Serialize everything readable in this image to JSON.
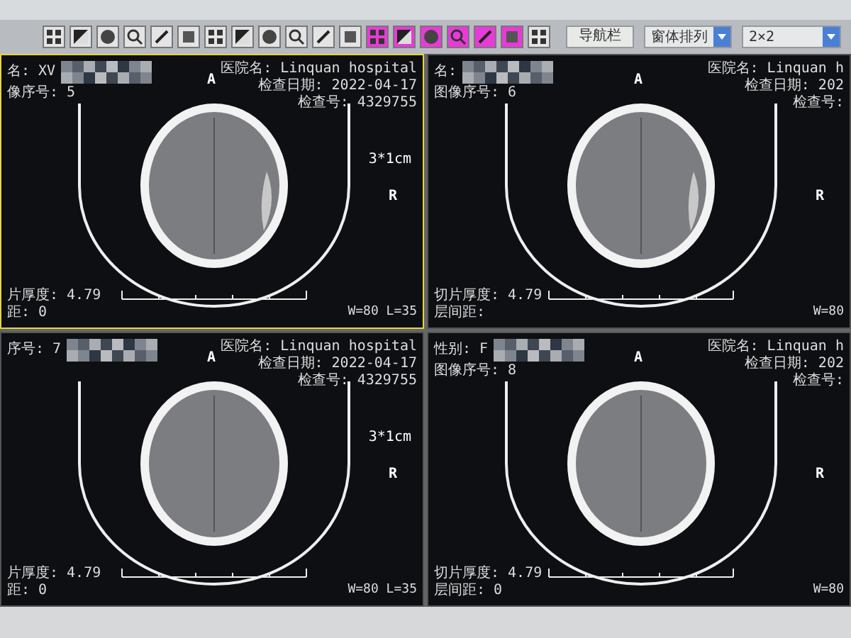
{
  "toolbar": {
    "tools": [
      {
        "active": false
      },
      {
        "active": false
      },
      {
        "active": false
      },
      {
        "active": false
      },
      {
        "active": false
      },
      {
        "active": false
      },
      {
        "active": false
      },
      {
        "active": false
      },
      {
        "active": false
      },
      {
        "active": false
      },
      {
        "active": false
      },
      {
        "active": false
      },
      {
        "active": true
      },
      {
        "active": true
      },
      {
        "active": true
      },
      {
        "active": true
      },
      {
        "active": true
      },
      {
        "active": true
      },
      {
        "active": false
      }
    ],
    "nav_button": "导航栏",
    "layout_select": "窗体排列",
    "grid_select": "2×2"
  },
  "viewports": [
    {
      "selected": true,
      "patient_lines": [
        "名: XV",
        "像序号: 5"
      ],
      "orientation_top": "A",
      "orientation_right": "R",
      "scale_label": "3*1cm",
      "hospital_lines": [
        "医院名: Linquan hospital",
        "检查日期: 2022-04-17",
        "检查号: 4329755"
      ],
      "slice_lines": [
        "片厚度: 4.79",
        "距: 0"
      ],
      "window": "W=80 L=35",
      "lesion": true
    },
    {
      "selected": false,
      "patient_lines": [
        "名:",
        "图像序号: 6"
      ],
      "orientation_top": "A",
      "orientation_right": "R",
      "hospital_lines": [
        "医院名: Linquan h",
        "检查日期: 202",
        "检查号:"
      ],
      "slice_lines": [
        "切片厚度: 4.79",
        "层间距:"
      ],
      "window": "W=80",
      "lesion": true
    },
    {
      "selected": false,
      "patient_lines": [
        "序号: 7"
      ],
      "orientation_top": "A",
      "orientation_right": "R",
      "scale_label": "3*1cm",
      "hospital_lines": [
        "医院名: Linquan hospital",
        "检查日期: 2022-04-17",
        "检查号: 4329755"
      ],
      "slice_lines": [
        "片厚度: 4.79",
        "距: 0"
      ],
      "window": "W=80 L=35",
      "lesion": false
    },
    {
      "selected": false,
      "patient_lines": [
        "性别: F",
        "图像序号: 8"
      ],
      "orientation_top": "A",
      "orientation_right": "R",
      "hospital_lines": [
        "医院名: Linquan h",
        "检查日期: 202",
        "检查号:"
      ],
      "slice_lines": [
        "切片厚度: 4.79",
        "层间距: 0"
      ],
      "window": "W=80",
      "lesion": false
    }
  ]
}
